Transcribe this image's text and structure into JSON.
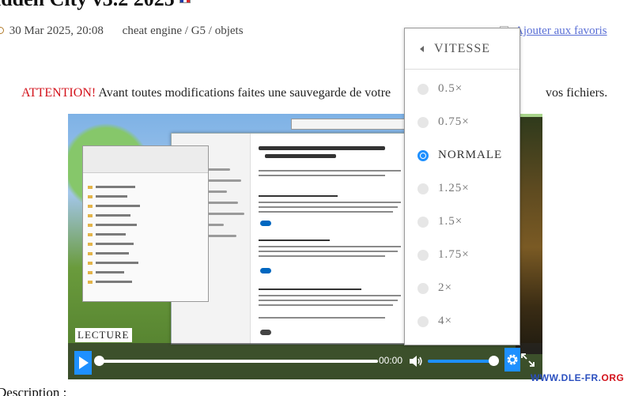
{
  "article": {
    "title": "idden City v3.2 2025",
    "date": "30 Mar 2025, 20:08",
    "category": "cheat engine / G5 / objets",
    "favorite_label": "Ajouter aux favoris",
    "warning_label": "ATTENTION!",
    "warning_text": " Avant toutes modifications faites une sauvegarde de votre",
    "warning_tail": "vos fichiers.",
    "description_label": "Description :"
  },
  "player": {
    "lecture_label": "LECTURE",
    "time": "00:00",
    "progress": 0,
    "volume": 1.0
  },
  "speed_menu": {
    "title": "VITESSE",
    "options": [
      "0.5×",
      "0.75×",
      "NORMALE",
      "1.25×",
      "1.5×",
      "1.75×",
      "2×",
      "4×"
    ],
    "selected": "NORMALE"
  },
  "watermark": {
    "text": "WWW.DLE-FR.",
    "tld": "ORG"
  },
  "colors": {
    "accent": "#1e90ff",
    "warning": "#d3121b",
    "link": "#5a6fd6"
  }
}
